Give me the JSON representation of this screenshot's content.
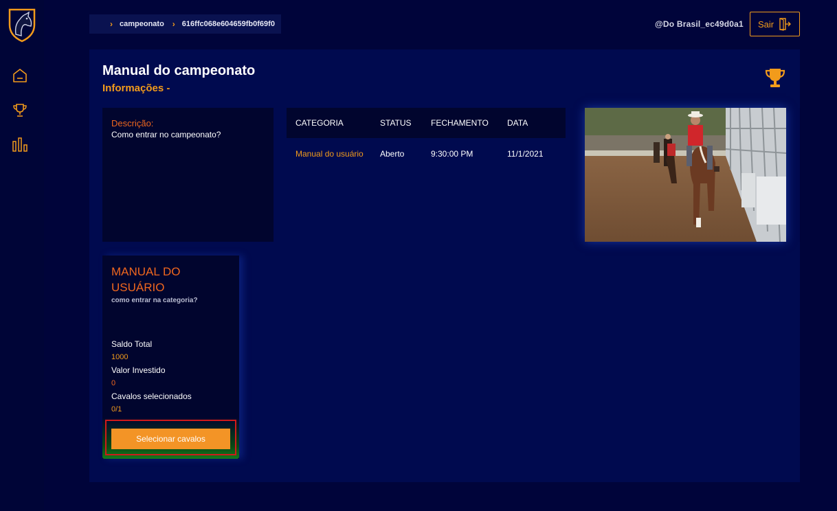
{
  "breadcrumb": {
    "items": [
      "campeonato",
      "616ffc068e604659fb0f69f0"
    ]
  },
  "header": {
    "username": "@Do Brasil_ec49d0a1",
    "logout_label": "Sair"
  },
  "page": {
    "title": "Manual do campeonato",
    "subtitle": "Informações -"
  },
  "description": {
    "label": "Descrição:",
    "text": "Como entrar no campeonato?"
  },
  "table": {
    "headers": [
      "CATEGORIA",
      "STATUS",
      "FECHAMENTO",
      "DATA"
    ],
    "rows": [
      [
        "Manual do usuário",
        "Aberto",
        "9:30:00 PM",
        "11/1/2021"
      ]
    ]
  },
  "card": {
    "title": "MANUAL DO USUÁRIO",
    "subtitle": "como entrar na categoria?",
    "saldo_label": "Saldo Total",
    "saldo_value": "1000",
    "investido_label": "Valor Investido",
    "investido_value": "0",
    "cavalos_label": "Cavalos selecionados",
    "cavalos_value": "0/1",
    "button_label": "Selecionar cavalos"
  },
  "colors": {
    "accent": "#f29b1b",
    "accent_red": "#f0671e",
    "background": "#00043a"
  },
  "icons": [
    "horse-logo",
    "home-icon",
    "trophy-icon",
    "bar-chart-icon",
    "logout-icon"
  ]
}
